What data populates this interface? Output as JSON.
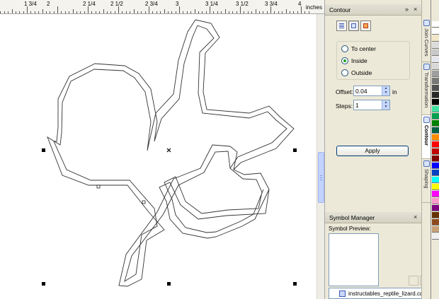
{
  "ruler": {
    "labels": [
      "1 3/4",
      "2",
      "2 1/4",
      "2 1/2",
      "2 3/4",
      "3",
      "3 1/4",
      "3 1/2",
      "3 3/4",
      "4"
    ],
    "unit": "inches"
  },
  "contour_docker": {
    "title": "Contour",
    "modes": [
      "to-center-mode",
      "inside-mode",
      "outside-mode"
    ],
    "active_mode": "inside-mode",
    "direction_options": [
      "To center",
      "Inside",
      "Outside"
    ],
    "selected_direction": "Inside",
    "offset_label": "Offset:",
    "offset_value": "0.04",
    "offset_unit": "in",
    "steps_label": "Steps:",
    "steps_value": "1",
    "apply_label": "Apply"
  },
  "symbol_manager": {
    "title": "Symbol Manager",
    "preview_label": "Symbol Preview:",
    "file_name": "instructables_reptile_lizard.cdr"
  },
  "docker_tabs": [
    "Join Curves",
    "Transformation",
    "Contour",
    "Shaping"
  ],
  "active_tab": "Contour",
  "palette": [
    "#ffffff",
    "#ffffff",
    "#f0e6c8",
    "#dcdcdc",
    "#c8c8c8",
    "#e6e6f0",
    "#d8d8d8",
    "#9e9e9e",
    "#787878",
    "#505050",
    "#282828",
    "#000000",
    "#40e0a0",
    "#00a050",
    "#008000",
    "#006040",
    "#ff8c00",
    "#ff0000",
    "#c00000",
    "#800000",
    "#0000ff",
    "#0040c0",
    "#00ffff",
    "#ffff00",
    "#ff00ff",
    "#ff99cc",
    "#800080",
    "#663300",
    "#8c4a1e",
    "#c8a078",
    "#f0f0f0"
  ],
  "colors": {
    "accent": "#003c74",
    "panel": "#ece9d8",
    "radio_on": "#21a121"
  }
}
